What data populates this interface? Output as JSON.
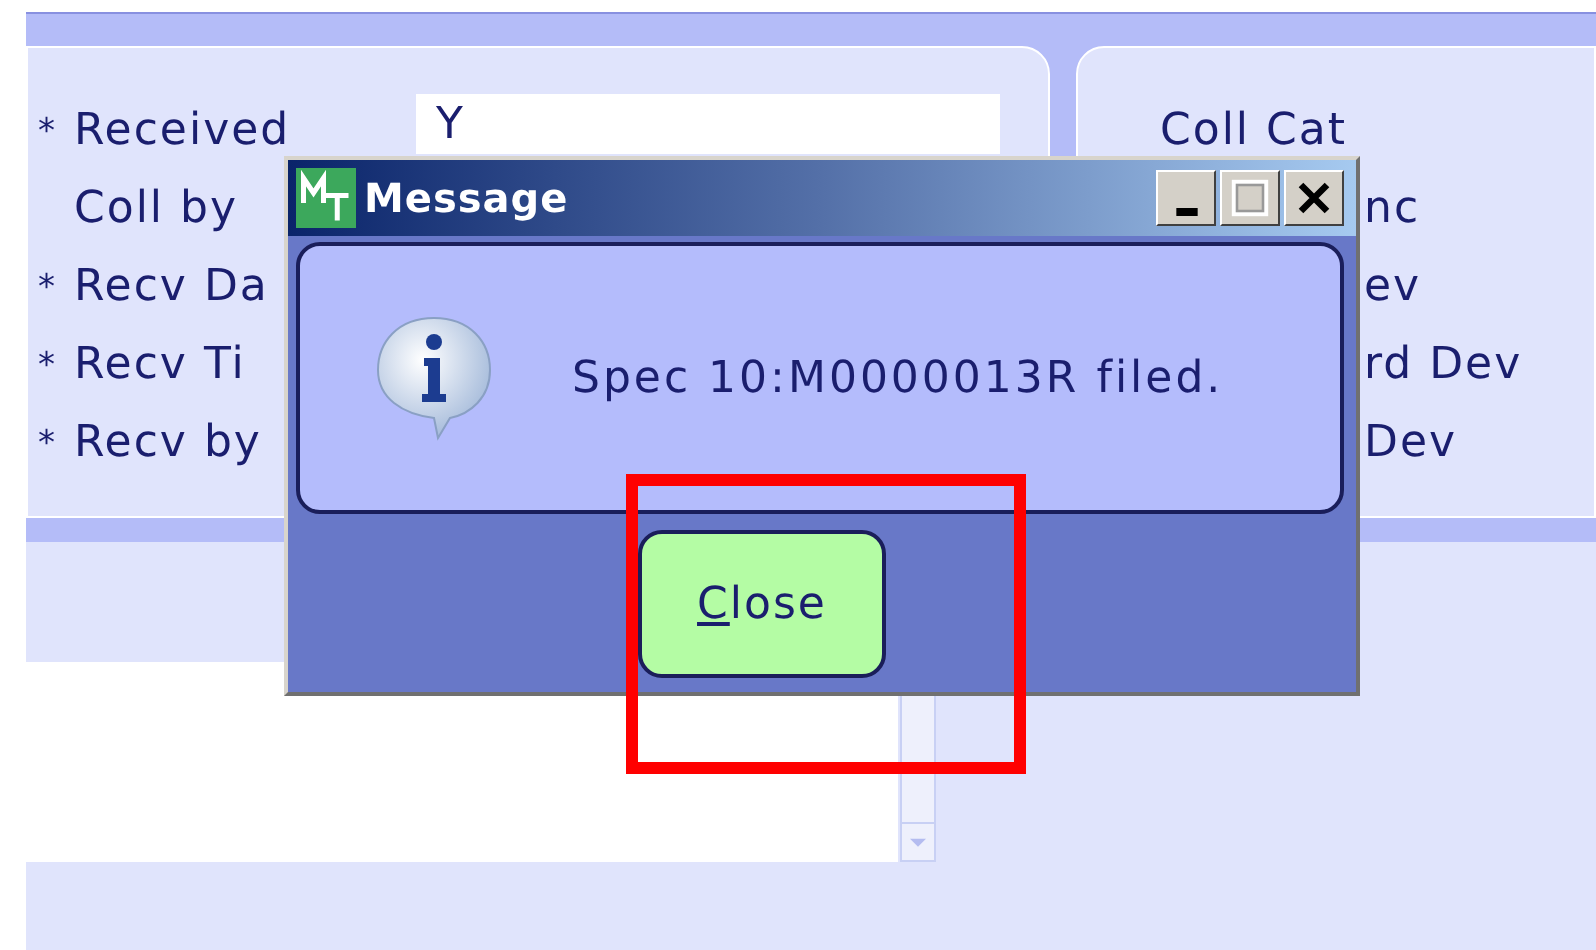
{
  "form": {
    "left_fields": [
      {
        "marker": "*",
        "label": "Received",
        "value": "Y"
      },
      {
        "label": "Coll by"
      },
      {
        "marker": "*",
        "label": "Recv Da"
      },
      {
        "marker": "*",
        "label": "Recv Ti"
      },
      {
        "marker": "*",
        "label": "Recv by"
      }
    ],
    "right_fields": [
      {
        "label": "Coll Cat",
        "partly_covered": false
      },
      {
        "label": "nc",
        "partly_covered": true
      },
      {
        "label": "ev",
        "partly_covered": true
      },
      {
        "label": "rd Dev",
        "partly_covered": true
      },
      {
        "label": "Dev",
        "partly_covered": true
      }
    ]
  },
  "dialog": {
    "title": "Message",
    "message": "Spec 10:M0000013R filed.",
    "button": "Close"
  }
}
